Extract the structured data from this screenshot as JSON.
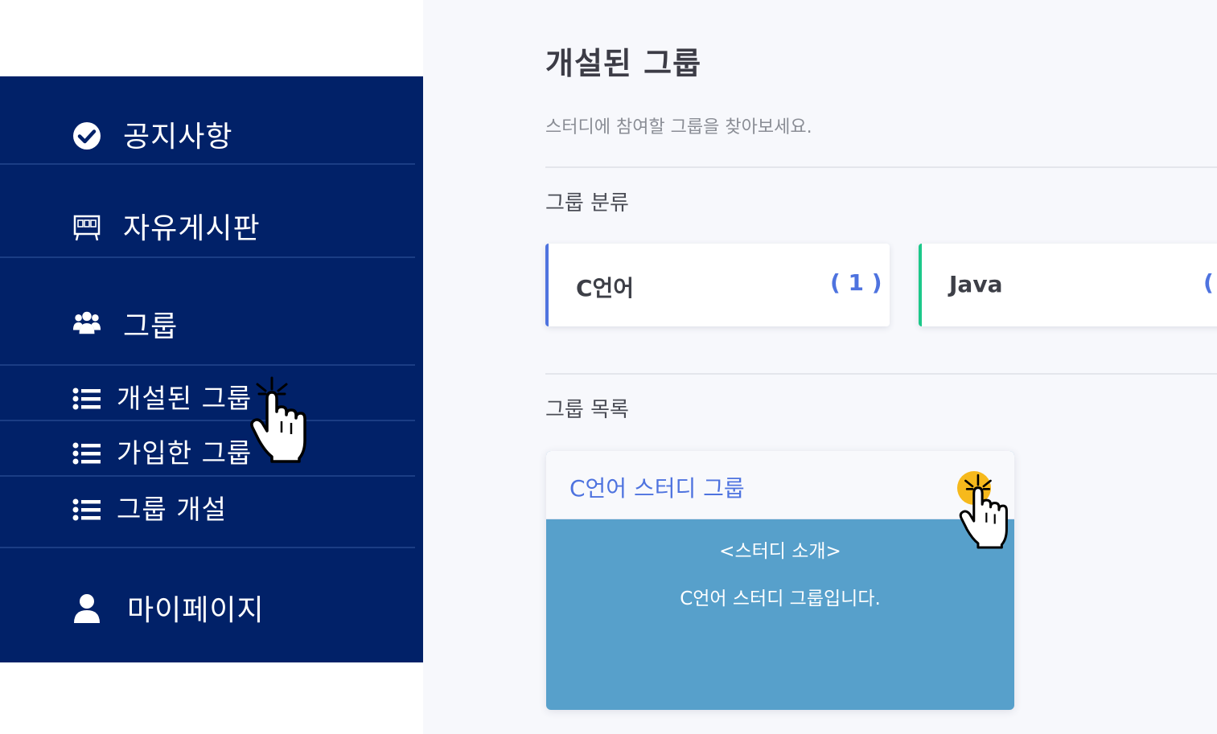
{
  "sidebar": {
    "items": [
      {
        "label": "공지사항",
        "icon": "check-circle-icon"
      },
      {
        "label": "자유게시판",
        "icon": "board-icon"
      },
      {
        "label": "그룹",
        "icon": "users-icon"
      },
      {
        "label": "개설된 그룹",
        "icon": "list-icon"
      },
      {
        "label": "가입한 그룹",
        "icon": "list-icon"
      },
      {
        "label": "그룹 개설",
        "icon": "list-icon"
      },
      {
        "label": "마이페이지",
        "icon": "user-icon"
      }
    ]
  },
  "main": {
    "title": "개설된 그룹",
    "subtitle": "스터디에 참여할 그룹을 찾아보세요.",
    "categories_label": "그룹 분류",
    "categories": [
      {
        "name": "C언어",
        "count": "( 1 )",
        "accent": "#4e73df"
      },
      {
        "name": "Java",
        "count": "(",
        "accent": "#1cc88a"
      }
    ],
    "groups_label": "그룹 목록",
    "groups": [
      {
        "title": "C언어 스터디 그룹",
        "intro_heading": "<스터디 소개>",
        "intro_text": "C언어 스터디 그룹입니다."
      }
    ]
  },
  "colors": {
    "sidebar_bg": "#012168",
    "link_blue": "#4e73df",
    "card_body": "#57a0cb",
    "click_highlight": "#f6b91c"
  }
}
